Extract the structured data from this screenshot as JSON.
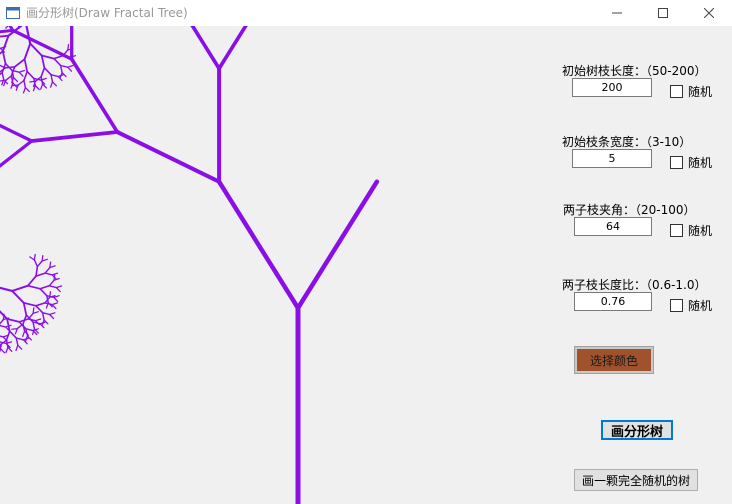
{
  "window": {
    "title": "画分形树(Draw Fractal Tree)",
    "controls": [
      "minimize",
      "maximize",
      "close"
    ]
  },
  "tree": {
    "color": "#8a0fe6",
    "trunk_length": 200,
    "trunk_width": 5,
    "angle_deg": 64,
    "length_ratio": 0.76
  },
  "params": {
    "length": {
      "label": "初始树枝长度：（50-200）",
      "value": "200",
      "random_label": "随机",
      "random_checked": false
    },
    "width": {
      "label": "初始枝条宽度：（3-10）",
      "value": "5",
      "random_label": "随机",
      "random_checked": false
    },
    "angle": {
      "label": "两子枝夹角：（20-100）",
      "value": "64",
      "random_label": "随机",
      "random_checked": false
    },
    "ratio": {
      "label": "两子枝长度比：（0.6-1.0）",
      "value": "0.76",
      "random_label": "随机",
      "random_checked": false
    }
  },
  "buttons": {
    "choose_color": "选择颜色",
    "choose_color_swatch": "#a0522d",
    "draw": "画分形树",
    "draw_random": "画一颗完全随机的树"
  }
}
